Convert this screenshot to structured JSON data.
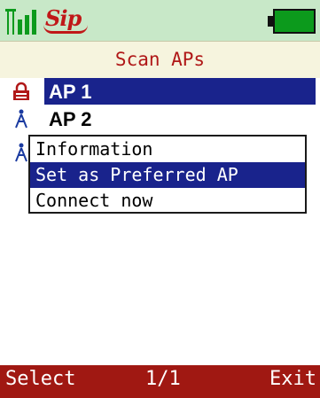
{
  "status_bar": {
    "signal_icon": "signal-bars-icon",
    "sip_label": "Sip",
    "battery_icon": "battery-icon",
    "colors": {
      "background": "#c8e8c8",
      "sip": "#c01818",
      "battery": "#0c9a1c"
    }
  },
  "title": "Scan APs",
  "ap_list": [
    {
      "label": "AP 1",
      "icon": "lock-icon",
      "selected": true
    },
    {
      "label": "AP 2",
      "icon": "antenna-icon",
      "selected": false
    }
  ],
  "popup_menu": {
    "items": [
      {
        "label": "Information",
        "selected": false
      },
      {
        "label": "Set as Preferred AP",
        "selected": true
      },
      {
        "label": "Connect now",
        "selected": false
      }
    ]
  },
  "softkeys": {
    "left": "Select",
    "center": "1/1",
    "right": "Exit"
  },
  "colors": {
    "title_text": "#b01818",
    "selection": "#19238c",
    "softkey_bar": "#a01812"
  }
}
